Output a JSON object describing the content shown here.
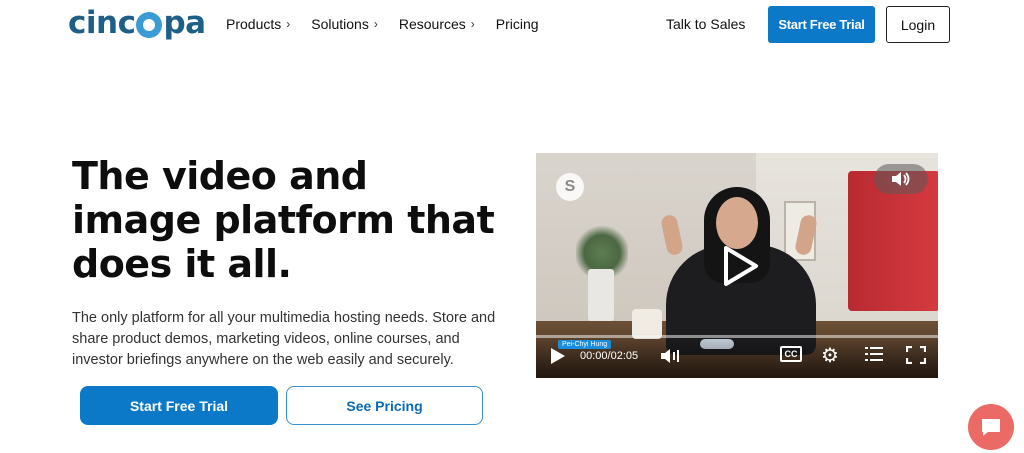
{
  "header": {
    "logo_text_before": "cinc",
    "logo_text_after": "pa",
    "nav": [
      {
        "label": "Products",
        "has_chevron": true
      },
      {
        "label": "Solutions",
        "has_chevron": true
      },
      {
        "label": "Resources",
        "has_chevron": true
      },
      {
        "label": "Pricing",
        "has_chevron": false
      }
    ],
    "talk_to_sales": "Talk to Sales",
    "start_trial": "Start Free Trial",
    "login": "Login"
  },
  "hero": {
    "title": "The video and image platform that does it all.",
    "subtitle": "The only platform for all your multimedia hosting needs. Store and share product demos, marketing videos, online courses, and investor briefings anywhere on the web easily and securely.",
    "primary_button": "Start Free Trial",
    "secondary_button": "See Pricing"
  },
  "video": {
    "speaker_tag": "Pei-Chyi Hung",
    "time_display": "00:00/02:05",
    "cc_label": "CC",
    "progress": 0.0
  },
  "colors": {
    "brand_dark": "#1d5f86",
    "brand_blue": "#0b78c8",
    "chat_coral": "#ec6a66"
  },
  "icons": [
    "chevron-right-icon",
    "play-icon",
    "volume-icon",
    "gear-icon",
    "list-icon",
    "fullscreen-icon",
    "chat-icon",
    "brand-icon"
  ]
}
